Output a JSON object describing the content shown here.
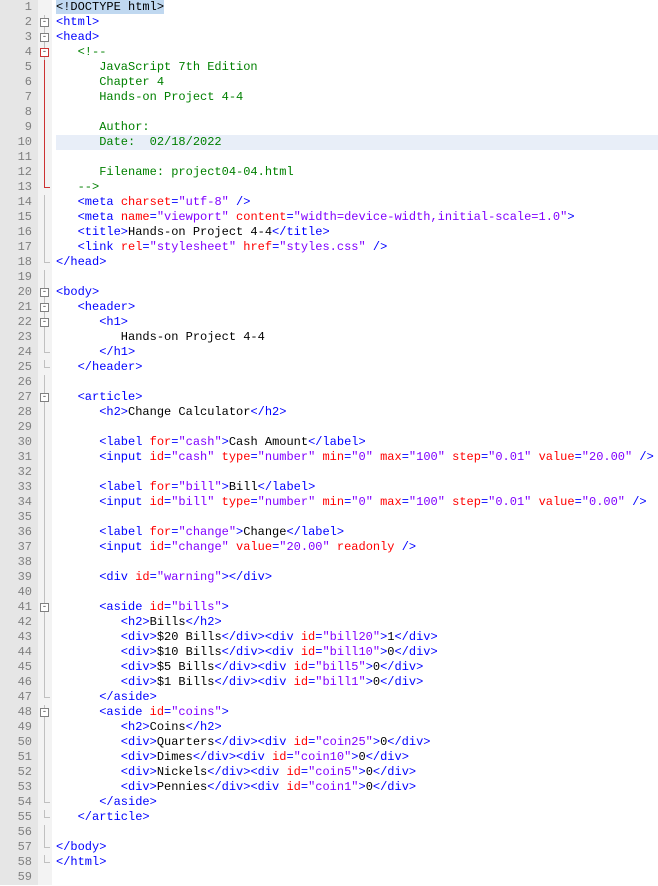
{
  "lines": [
    {
      "n": 1,
      "fold": "",
      "seg": [
        {
          "c": "sel-doctype",
          "t": "<!DOCTYPE html>"
        }
      ]
    },
    {
      "n": 2,
      "fold": "box",
      "seg": [
        {
          "c": "t-tag",
          "t": "<html>"
        }
      ]
    },
    {
      "n": 3,
      "fold": "box",
      "seg": [
        {
          "c": "t-tag",
          "t": "<head>"
        }
      ]
    },
    {
      "n": 4,
      "fold": "boxred",
      "seg": [
        {
          "c": "t-comment",
          "t": "   <!--"
        }
      ]
    },
    {
      "n": 5,
      "fold": "linered",
      "seg": [
        {
          "c": "t-comment",
          "t": "      JavaScript 7th Edition"
        }
      ]
    },
    {
      "n": 6,
      "fold": "linered",
      "seg": [
        {
          "c": "t-comment",
          "t": "      Chapter 4"
        }
      ]
    },
    {
      "n": 7,
      "fold": "linered",
      "seg": [
        {
          "c": "t-comment",
          "t": "      Hands-on Project 4-4"
        }
      ]
    },
    {
      "n": 8,
      "fold": "linered",
      "seg": [
        {
          "c": "t-comment",
          "t": ""
        }
      ]
    },
    {
      "n": 9,
      "fold": "linered",
      "seg": [
        {
          "c": "t-comment",
          "t": "      Author:"
        }
      ]
    },
    {
      "n": 10,
      "fold": "linered",
      "hl": true,
      "seg": [
        {
          "c": "t-comment",
          "t": "      Date:  02/18/2022"
        }
      ]
    },
    {
      "n": 11,
      "fold": "linered",
      "seg": [
        {
          "c": "t-comment",
          "t": ""
        }
      ]
    },
    {
      "n": 12,
      "fold": "linered",
      "seg": [
        {
          "c": "t-comment",
          "t": "      Filename: project04-04.html"
        }
      ]
    },
    {
      "n": 13,
      "fold": "endred",
      "seg": [
        {
          "c": "t-comment",
          "t": "   -->"
        }
      ]
    },
    {
      "n": 14,
      "fold": "line",
      "seg": [
        {
          "c": "t-tag",
          "t": "   <meta "
        },
        {
          "c": "t-attr",
          "t": "charset"
        },
        {
          "c": "t-tag",
          "t": "="
        },
        {
          "c": "t-str",
          "t": "\"utf-8\""
        },
        {
          "c": "t-tag",
          "t": " />"
        }
      ]
    },
    {
      "n": 15,
      "fold": "line",
      "seg": [
        {
          "c": "t-tag",
          "t": "   <meta "
        },
        {
          "c": "t-attr",
          "t": "name"
        },
        {
          "c": "t-tag",
          "t": "="
        },
        {
          "c": "t-str",
          "t": "\"viewport\""
        },
        {
          "c": "t-attr",
          "t": " content"
        },
        {
          "c": "t-tag",
          "t": "="
        },
        {
          "c": "t-str",
          "t": "\"width=device-width,initial-scale=1.0\""
        },
        {
          "c": "t-tag",
          "t": ">"
        }
      ]
    },
    {
      "n": 16,
      "fold": "line",
      "seg": [
        {
          "c": "t-tag",
          "t": "   <title>"
        },
        {
          "c": "t-text",
          "t": "Hands-on Project 4-4"
        },
        {
          "c": "t-tag",
          "t": "</title>"
        }
      ]
    },
    {
      "n": 17,
      "fold": "line",
      "seg": [
        {
          "c": "t-tag",
          "t": "   <link "
        },
        {
          "c": "t-attr",
          "t": "rel"
        },
        {
          "c": "t-tag",
          "t": "="
        },
        {
          "c": "t-str",
          "t": "\"stylesheet\""
        },
        {
          "c": "t-attr",
          "t": " href"
        },
        {
          "c": "t-tag",
          "t": "="
        },
        {
          "c": "t-str",
          "t": "\"styles.css\""
        },
        {
          "c": "t-tag",
          "t": " />"
        }
      ]
    },
    {
      "n": 18,
      "fold": "end",
      "seg": [
        {
          "c": "t-tag",
          "t": "</head>"
        }
      ]
    },
    {
      "n": 19,
      "fold": "line",
      "seg": []
    },
    {
      "n": 20,
      "fold": "box",
      "seg": [
        {
          "c": "t-tag",
          "t": "<body>"
        }
      ]
    },
    {
      "n": 21,
      "fold": "box",
      "seg": [
        {
          "c": "t-tag",
          "t": "   <header>"
        }
      ]
    },
    {
      "n": 22,
      "fold": "box",
      "seg": [
        {
          "c": "t-tag",
          "t": "      <h1>"
        }
      ]
    },
    {
      "n": 23,
      "fold": "line",
      "seg": [
        {
          "c": "t-text",
          "t": "         Hands-on Project 4-4"
        }
      ]
    },
    {
      "n": 24,
      "fold": "end",
      "seg": [
        {
          "c": "t-tag",
          "t": "      </h1>"
        }
      ]
    },
    {
      "n": 25,
      "fold": "end",
      "seg": [
        {
          "c": "t-tag",
          "t": "   </header>"
        }
      ]
    },
    {
      "n": 26,
      "fold": "line",
      "seg": []
    },
    {
      "n": 27,
      "fold": "box",
      "seg": [
        {
          "c": "t-tag",
          "t": "   <article>"
        }
      ]
    },
    {
      "n": 28,
      "fold": "line",
      "seg": [
        {
          "c": "t-tag",
          "t": "      <h2>"
        },
        {
          "c": "t-text",
          "t": "Change Calculator"
        },
        {
          "c": "t-tag",
          "t": "</h2>"
        }
      ]
    },
    {
      "n": 29,
      "fold": "line",
      "seg": []
    },
    {
      "n": 30,
      "fold": "line",
      "seg": [
        {
          "c": "t-tag",
          "t": "      <label "
        },
        {
          "c": "t-attr",
          "t": "for"
        },
        {
          "c": "t-tag",
          "t": "="
        },
        {
          "c": "t-str",
          "t": "\"cash\""
        },
        {
          "c": "t-tag",
          "t": ">"
        },
        {
          "c": "t-text",
          "t": "Cash Amount"
        },
        {
          "c": "t-tag",
          "t": "</label>"
        }
      ]
    },
    {
      "n": 31,
      "fold": "line",
      "seg": [
        {
          "c": "t-tag",
          "t": "      <input "
        },
        {
          "c": "t-attr",
          "t": "id"
        },
        {
          "c": "t-tag",
          "t": "="
        },
        {
          "c": "t-str",
          "t": "\"cash\""
        },
        {
          "c": "t-attr",
          "t": " type"
        },
        {
          "c": "t-tag",
          "t": "="
        },
        {
          "c": "t-str",
          "t": "\"number\""
        },
        {
          "c": "t-attr",
          "t": " min"
        },
        {
          "c": "t-tag",
          "t": "="
        },
        {
          "c": "t-str",
          "t": "\"0\""
        },
        {
          "c": "t-attr",
          "t": " max"
        },
        {
          "c": "t-tag",
          "t": "="
        },
        {
          "c": "t-str",
          "t": "\"100\""
        },
        {
          "c": "t-attr",
          "t": " step"
        },
        {
          "c": "t-tag",
          "t": "="
        },
        {
          "c": "t-str",
          "t": "\"0.01\""
        },
        {
          "c": "t-attr",
          "t": " value"
        },
        {
          "c": "t-tag",
          "t": "="
        },
        {
          "c": "t-str",
          "t": "\"20.00\""
        },
        {
          "c": "t-tag",
          "t": " />"
        }
      ]
    },
    {
      "n": 32,
      "fold": "line",
      "seg": []
    },
    {
      "n": 33,
      "fold": "line",
      "seg": [
        {
          "c": "t-tag",
          "t": "      <label "
        },
        {
          "c": "t-attr",
          "t": "for"
        },
        {
          "c": "t-tag",
          "t": "="
        },
        {
          "c": "t-str",
          "t": "\"bill\""
        },
        {
          "c": "t-tag",
          "t": ">"
        },
        {
          "c": "t-text",
          "t": "Bill"
        },
        {
          "c": "t-tag",
          "t": "</label>"
        }
      ]
    },
    {
      "n": 34,
      "fold": "line",
      "seg": [
        {
          "c": "t-tag",
          "t": "      <input "
        },
        {
          "c": "t-attr",
          "t": "id"
        },
        {
          "c": "t-tag",
          "t": "="
        },
        {
          "c": "t-str",
          "t": "\"bill\""
        },
        {
          "c": "t-attr",
          "t": " type"
        },
        {
          "c": "t-tag",
          "t": "="
        },
        {
          "c": "t-str",
          "t": "\"number\""
        },
        {
          "c": "t-attr",
          "t": " min"
        },
        {
          "c": "t-tag",
          "t": "="
        },
        {
          "c": "t-str",
          "t": "\"0\""
        },
        {
          "c": "t-attr",
          "t": " max"
        },
        {
          "c": "t-tag",
          "t": "="
        },
        {
          "c": "t-str",
          "t": "\"100\""
        },
        {
          "c": "t-attr",
          "t": " step"
        },
        {
          "c": "t-tag",
          "t": "="
        },
        {
          "c": "t-str",
          "t": "\"0.01\""
        },
        {
          "c": "t-attr",
          "t": " value"
        },
        {
          "c": "t-tag",
          "t": "="
        },
        {
          "c": "t-str",
          "t": "\"0.00\""
        },
        {
          "c": "t-tag",
          "t": " />"
        }
      ]
    },
    {
      "n": 35,
      "fold": "line",
      "seg": []
    },
    {
      "n": 36,
      "fold": "line",
      "seg": [
        {
          "c": "t-tag",
          "t": "      <label "
        },
        {
          "c": "t-attr",
          "t": "for"
        },
        {
          "c": "t-tag",
          "t": "="
        },
        {
          "c": "t-str",
          "t": "\"change\""
        },
        {
          "c": "t-tag",
          "t": ">"
        },
        {
          "c": "t-text",
          "t": "Change"
        },
        {
          "c": "t-tag",
          "t": "</label>"
        }
      ]
    },
    {
      "n": 37,
      "fold": "line",
      "seg": [
        {
          "c": "t-tag",
          "t": "      <input "
        },
        {
          "c": "t-attr",
          "t": "id"
        },
        {
          "c": "t-tag",
          "t": "="
        },
        {
          "c": "t-str",
          "t": "\"change\""
        },
        {
          "c": "t-attr",
          "t": " value"
        },
        {
          "c": "t-tag",
          "t": "="
        },
        {
          "c": "t-str",
          "t": "\"20.00\""
        },
        {
          "c": "t-attr",
          "t": " readonly"
        },
        {
          "c": "t-tag",
          "t": " />"
        }
      ]
    },
    {
      "n": 38,
      "fold": "line",
      "seg": []
    },
    {
      "n": 39,
      "fold": "line",
      "seg": [
        {
          "c": "t-tag",
          "t": "      <div "
        },
        {
          "c": "t-attr",
          "t": "id"
        },
        {
          "c": "t-tag",
          "t": "="
        },
        {
          "c": "t-str",
          "t": "\"warning\""
        },
        {
          "c": "t-tag",
          "t": "></div>"
        }
      ]
    },
    {
      "n": 40,
      "fold": "line",
      "seg": []
    },
    {
      "n": 41,
      "fold": "box",
      "seg": [
        {
          "c": "t-tag",
          "t": "      <aside "
        },
        {
          "c": "t-attr",
          "t": "id"
        },
        {
          "c": "t-tag",
          "t": "="
        },
        {
          "c": "t-str",
          "t": "\"bills\""
        },
        {
          "c": "t-tag",
          "t": ">"
        }
      ]
    },
    {
      "n": 42,
      "fold": "line",
      "seg": [
        {
          "c": "t-tag",
          "t": "         <h2>"
        },
        {
          "c": "t-text",
          "t": "Bills"
        },
        {
          "c": "t-tag",
          "t": "</h2>"
        }
      ]
    },
    {
      "n": 43,
      "fold": "line",
      "seg": [
        {
          "c": "t-tag",
          "t": "         <div>"
        },
        {
          "c": "t-text",
          "t": "$20 Bills"
        },
        {
          "c": "t-tag",
          "t": "</div><div "
        },
        {
          "c": "t-attr",
          "t": "id"
        },
        {
          "c": "t-tag",
          "t": "="
        },
        {
          "c": "t-str",
          "t": "\"bill20\""
        },
        {
          "c": "t-tag",
          "t": ">"
        },
        {
          "c": "t-text",
          "t": "1"
        },
        {
          "c": "t-tag",
          "t": "</div>"
        }
      ]
    },
    {
      "n": 44,
      "fold": "line",
      "seg": [
        {
          "c": "t-tag",
          "t": "         <div>"
        },
        {
          "c": "t-text",
          "t": "$10 Bills"
        },
        {
          "c": "t-tag",
          "t": "</div><div "
        },
        {
          "c": "t-attr",
          "t": "id"
        },
        {
          "c": "t-tag",
          "t": "="
        },
        {
          "c": "t-str",
          "t": "\"bill10\""
        },
        {
          "c": "t-tag",
          "t": ">"
        },
        {
          "c": "t-text",
          "t": "0"
        },
        {
          "c": "t-tag",
          "t": "</div>"
        }
      ]
    },
    {
      "n": 45,
      "fold": "line",
      "seg": [
        {
          "c": "t-tag",
          "t": "         <div>"
        },
        {
          "c": "t-text",
          "t": "$5 Bills"
        },
        {
          "c": "t-tag",
          "t": "</div><div "
        },
        {
          "c": "t-attr",
          "t": "id"
        },
        {
          "c": "t-tag",
          "t": "="
        },
        {
          "c": "t-str",
          "t": "\"bill5\""
        },
        {
          "c": "t-tag",
          "t": ">"
        },
        {
          "c": "t-text",
          "t": "0"
        },
        {
          "c": "t-tag",
          "t": "</div>"
        }
      ]
    },
    {
      "n": 46,
      "fold": "line",
      "seg": [
        {
          "c": "t-tag",
          "t": "         <div>"
        },
        {
          "c": "t-text",
          "t": "$1 Bills"
        },
        {
          "c": "t-tag",
          "t": "</div><div "
        },
        {
          "c": "t-attr",
          "t": "id"
        },
        {
          "c": "t-tag",
          "t": "="
        },
        {
          "c": "t-str",
          "t": "\"bill1\""
        },
        {
          "c": "t-tag",
          "t": ">"
        },
        {
          "c": "t-text",
          "t": "0"
        },
        {
          "c": "t-tag",
          "t": "</div>"
        }
      ]
    },
    {
      "n": 47,
      "fold": "end",
      "seg": [
        {
          "c": "t-tag",
          "t": "      </aside>"
        }
      ]
    },
    {
      "n": 48,
      "fold": "box",
      "seg": [
        {
          "c": "t-tag",
          "t": "      <aside "
        },
        {
          "c": "t-attr",
          "t": "id"
        },
        {
          "c": "t-tag",
          "t": "="
        },
        {
          "c": "t-str",
          "t": "\"coins\""
        },
        {
          "c": "t-tag",
          "t": ">"
        }
      ]
    },
    {
      "n": 49,
      "fold": "line",
      "seg": [
        {
          "c": "t-tag",
          "t": "         <h2>"
        },
        {
          "c": "t-text",
          "t": "Coins"
        },
        {
          "c": "t-tag",
          "t": "</h2>"
        }
      ]
    },
    {
      "n": 50,
      "fold": "line",
      "seg": [
        {
          "c": "t-tag",
          "t": "         <div>"
        },
        {
          "c": "t-text",
          "t": "Quarters"
        },
        {
          "c": "t-tag",
          "t": "</div><div "
        },
        {
          "c": "t-attr",
          "t": "id"
        },
        {
          "c": "t-tag",
          "t": "="
        },
        {
          "c": "t-str",
          "t": "\"coin25\""
        },
        {
          "c": "t-tag",
          "t": ">"
        },
        {
          "c": "t-text",
          "t": "0"
        },
        {
          "c": "t-tag",
          "t": "</div>"
        }
      ]
    },
    {
      "n": 51,
      "fold": "line",
      "seg": [
        {
          "c": "t-tag",
          "t": "         <div>"
        },
        {
          "c": "t-text",
          "t": "Dimes"
        },
        {
          "c": "t-tag",
          "t": "</div><div "
        },
        {
          "c": "t-attr",
          "t": "id"
        },
        {
          "c": "t-tag",
          "t": "="
        },
        {
          "c": "t-str",
          "t": "\"coin10\""
        },
        {
          "c": "t-tag",
          "t": ">"
        },
        {
          "c": "t-text",
          "t": "0"
        },
        {
          "c": "t-tag",
          "t": "</div>"
        }
      ]
    },
    {
      "n": 52,
      "fold": "line",
      "seg": [
        {
          "c": "t-tag",
          "t": "         <div>"
        },
        {
          "c": "t-text",
          "t": "Nickels"
        },
        {
          "c": "t-tag",
          "t": "</div><div "
        },
        {
          "c": "t-attr",
          "t": "id"
        },
        {
          "c": "t-tag",
          "t": "="
        },
        {
          "c": "t-str",
          "t": "\"coin5\""
        },
        {
          "c": "t-tag",
          "t": ">"
        },
        {
          "c": "t-text",
          "t": "0"
        },
        {
          "c": "t-tag",
          "t": "</div>"
        }
      ]
    },
    {
      "n": 53,
      "fold": "line",
      "seg": [
        {
          "c": "t-tag",
          "t": "         <div>"
        },
        {
          "c": "t-text",
          "t": "Pennies"
        },
        {
          "c": "t-tag",
          "t": "</div><div "
        },
        {
          "c": "t-attr",
          "t": "id"
        },
        {
          "c": "t-tag",
          "t": "="
        },
        {
          "c": "t-str",
          "t": "\"coin1\""
        },
        {
          "c": "t-tag",
          "t": ">"
        },
        {
          "c": "t-text",
          "t": "0"
        },
        {
          "c": "t-tag",
          "t": "</div>"
        }
      ]
    },
    {
      "n": 54,
      "fold": "end",
      "seg": [
        {
          "c": "t-tag",
          "t": "      </aside>"
        }
      ]
    },
    {
      "n": 55,
      "fold": "end",
      "seg": [
        {
          "c": "t-tag",
          "t": "   </article>"
        }
      ]
    },
    {
      "n": 56,
      "fold": "line",
      "seg": []
    },
    {
      "n": 57,
      "fold": "end",
      "seg": [
        {
          "c": "t-tag",
          "t": "</body>"
        }
      ]
    },
    {
      "n": 58,
      "fold": "end",
      "seg": [
        {
          "c": "t-tag",
          "t": "</html>"
        }
      ]
    },
    {
      "n": 59,
      "fold": "",
      "seg": []
    }
  ]
}
